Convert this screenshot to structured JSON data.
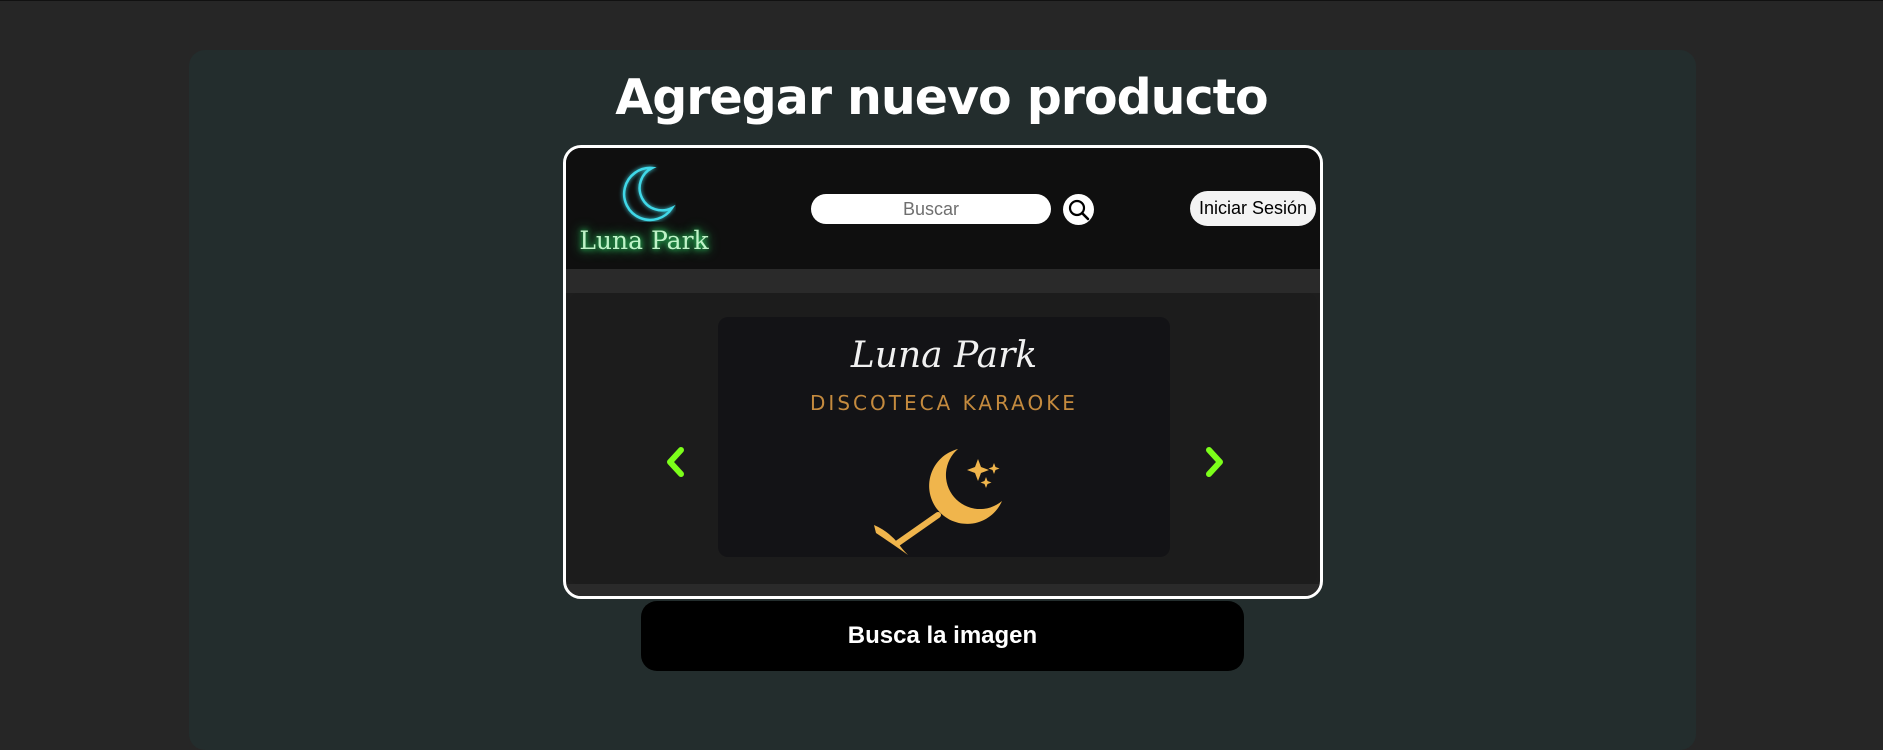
{
  "page": {
    "title": "Agregar nuevo producto"
  },
  "preview": {
    "logo": {
      "icon": "crescent-moon-icon",
      "text": "Luna Park",
      "moon_color": "#3fd8e8",
      "text_glow_color": "#2ee06a"
    },
    "search": {
      "placeholder": "Buscar",
      "value": "",
      "icon": "search-icon"
    },
    "login_label": "Iniciar Sesión",
    "carousel": {
      "prev_icon": "chevron-left-icon",
      "next_icon": "chevron-right-icon",
      "arrow_color": "#7cff1a",
      "slide": {
        "script_text": "Luna Park",
        "subtitle": "DISCOTECA KARAOKE",
        "art": "moon-cocktail-glass-icon",
        "art_color": "#f0b54c"
      }
    }
  },
  "actions": {
    "browse_label": "Busca la imagen"
  },
  "colors": {
    "page_bg": "#262626",
    "panel_bg": "#232d2d",
    "preview_border": "#ffffff"
  }
}
